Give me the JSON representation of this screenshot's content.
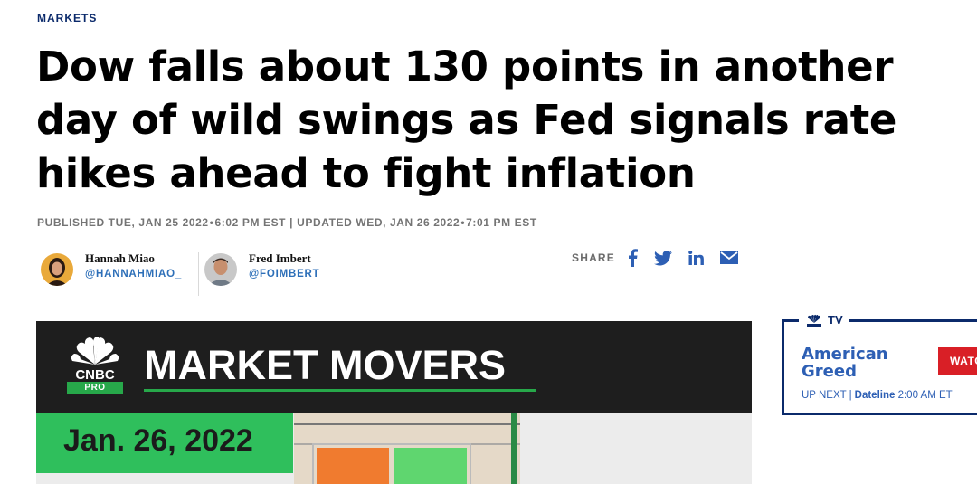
{
  "section": "MARKETS",
  "headline": "Dow falls about 130 points in another day of wild swings as Fed signals rate hikes ahead to fight inflation",
  "timestamps": {
    "published_label": "PUBLISHED TUE, JAN 25 2022",
    "published_time": "6:02 PM EST",
    "separator": "|",
    "updated_label": "UPDATED WED, JAN 26 2022",
    "updated_time": "7:01 PM EST"
  },
  "authors": [
    {
      "name": "Hannah Miao",
      "handle": "@HANNAHMIAO_"
    },
    {
      "name": "Fred Imbert",
      "handle": "@FOIMBERT"
    }
  ],
  "share": {
    "label": "SHARE",
    "icons": [
      "facebook-icon",
      "twitter-icon",
      "linkedin-icon",
      "email-icon"
    ]
  },
  "video": {
    "brand": "CNBC",
    "badge": "PRO",
    "title": "MARKET MOVERS",
    "date": "Jan. 26, 2022"
  },
  "tv": {
    "tab_label": "TV",
    "show_line1": "American",
    "show_line2": "Greed",
    "watch_label": "WATC",
    "upnext_label": "UP NEXT",
    "upnext_separator": "|",
    "upnext_show": "Dateline",
    "upnext_time": "2:00 AM ET"
  },
  "colors": {
    "navy": "#0b2a6b",
    "link_blue": "#2d6fb8",
    "cnbc_green": "#27a84a",
    "watch_red": "#d91f26"
  }
}
